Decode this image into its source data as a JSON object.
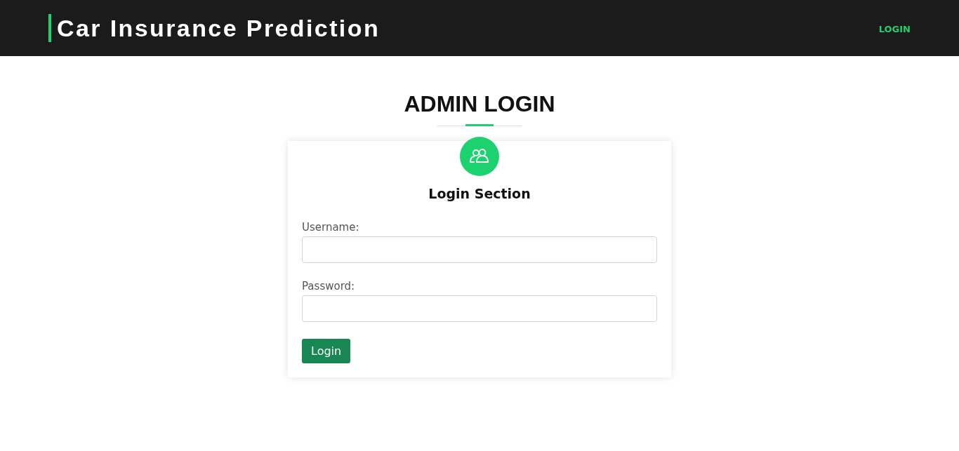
{
  "header": {
    "title": "Car Insurance Prediction",
    "nav": [
      "LOGIN"
    ]
  },
  "page_title": "ADMIN LOGIN",
  "card": {
    "title": "Login Section",
    "fields": [
      {
        "label": "Username:"
      },
      {
        "label": "Password:"
      }
    ],
    "button": "Login"
  }
}
